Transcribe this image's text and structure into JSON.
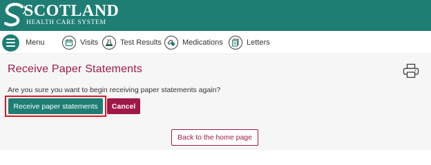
{
  "brand": {
    "name": "SCOTLAND",
    "subtitle": "HEALTH CARE SYSTEM",
    "header_color": "#1e7e74",
    "accent_color": "#a0174a"
  },
  "nav": {
    "menu": {
      "label": "Menu",
      "icon": "hamburger-icon"
    },
    "items": [
      {
        "label": "Visits",
        "icon": "calendar-icon"
      },
      {
        "label": "Test Results",
        "icon": "flask-icon"
      },
      {
        "label": "Medications",
        "icon": "pills-icon"
      },
      {
        "label": "Letters",
        "icon": "letters-icon"
      }
    ]
  },
  "page": {
    "title": "Receive Paper Statements",
    "prompt": "Are you sure you want to begin receiving paper statements again?",
    "print_icon": "printer-icon"
  },
  "actions": {
    "confirm_label": "Receive paper statements",
    "cancel_label": "Cancel",
    "home_label": "Back to the home page"
  }
}
